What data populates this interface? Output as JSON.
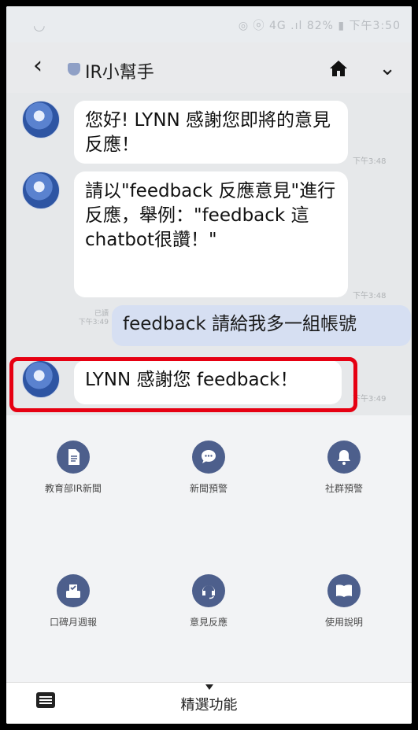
{
  "status_bar": {
    "text": "◎ ⓞ 4G .ıl 82% ▮ 下午3:50"
  },
  "header": {
    "back_icon": "chevron-left-icon",
    "title": "IR小幫手",
    "home_icon": "home-icon",
    "more_icon": "chevron-down-icon"
  },
  "messages": [
    {
      "sender": "bot",
      "text": "您好! LYNN 感謝您即將的意見反應！",
      "time": "下午3:48"
    },
    {
      "sender": "bot",
      "text": "請以\"feedback 反應意見\"進行反應，舉例：\"feedback 這chatbot很讚！\"",
      "time": "下午3:48"
    },
    {
      "sender": "me",
      "text": "feedback 請給我多一組帳號",
      "read": "已讀",
      "time": "下午3:49"
    },
    {
      "sender": "bot",
      "text": "LYNN 感謝您 feedback！",
      "time": "下午3:49"
    }
  ],
  "menu": {
    "items": [
      {
        "label": "教育部IR新聞",
        "icon": "document-icon"
      },
      {
        "label": "新聞預警",
        "icon": "chat-bubble-icon"
      },
      {
        "label": "社群預警",
        "icon": "bell-icon"
      },
      {
        "label": "口碑月週報",
        "icon": "inbox-check-icon"
      },
      {
        "label": "意見反應",
        "icon": "headset-icon"
      },
      {
        "label": "使用說明",
        "icon": "book-icon"
      }
    ]
  },
  "bottom_bar": {
    "label": "精選功能",
    "keyboard_icon": "keyboard-icon"
  },
  "colors": {
    "highlight": "#e60012",
    "menu_icon": "#4d5f8c",
    "my_bubble": "#d6dff2"
  }
}
